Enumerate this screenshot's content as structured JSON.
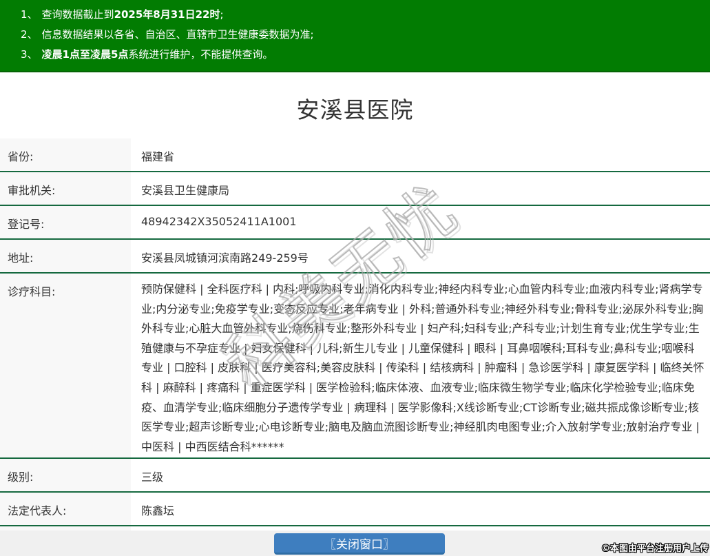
{
  "notice": {
    "items": [
      {
        "num": "1、",
        "pre": "查询数据截止到",
        "bold": "2025年8月31日22时",
        "post": ";"
      },
      {
        "num": "2、",
        "pre": "信息数据结果以各省、自治区、直辖市卫生健康委数据为准;",
        "bold": "",
        "post": ""
      },
      {
        "num": "3、",
        "pre": "",
        "bold": "凌晨1点至凌晨5点",
        "post": "系统进行维护，不能提供查询。"
      }
    ]
  },
  "title": "安溪县医院",
  "table": {
    "rows": [
      {
        "label": "省份:",
        "value": "福建省"
      },
      {
        "label": "审批机关:",
        "value": "安溪县卫生健康局"
      },
      {
        "label": "登记号:",
        "value": "48942342X35052411A1001"
      },
      {
        "label": "地址:",
        "value": "安溪县凤城镇河滨南路249-259号"
      },
      {
        "label": "诊疗科目:",
        "value": "预防保健科 | 全科医疗科 | 内科;呼吸内科专业;消化内科专业;神经内科专业;心血管内科专业;血液内科专业;肾病学专业;内分泌专业;免疫学专业;变态反应专业;老年病专业 | 外科;普通外科专业;神经外科专业;骨科专业;泌尿外科专业;胸外科专业;心脏大血管外科专业;烧伤科专业;整形外科专业 | 妇产科;妇科专业;产科专业;计划生育专业;优生学专业;生殖健康与不孕症专业 | 妇女保健科 | 儿科;新生儿专业 | 儿童保健科 | 眼科 | 耳鼻咽喉科;耳科专业;鼻科专业;咽喉科专业 | 口腔科 | 皮肤科 | 医疗美容科;美容皮肤科 | 传染科 | 结核病科 | 肿瘤科 | 急诊医学科 | 康复医学科 | 临终关怀科 | 麻醉科 | 疼痛科 | 重症医学科 | 医学检验科;临床体液、血液专业;临床微生物学专业;临床化学检验专业;临床免疫、血清学专业;临床细胞分子遗传学专业 | 病理科 | 医学影像科;X线诊断专业;CT诊断专业;磁共振成像诊断专业;核医学专业;超声诊断专业;心电诊断专业;脑电及脑血流图诊断专业;神经肌肉电图专业;介入放射学专业;放射治疗专业 | 中医科 | 中西医结合科******"
      },
      {
        "label": "级别:",
        "value": "三级"
      },
      {
        "label": "法定代表人:",
        "value": "陈鑫坛"
      }
    ]
  },
  "watermark": "科美无忧",
  "footer": {
    "close_button": "〖关闭窗口〗",
    "copyright": "©本图由平台注册用户上传"
  },
  "colors": {
    "header_green": "#027c02",
    "separator_green": "#15693f",
    "label_bg": "#f8f8f8",
    "button_blue": "#3e7ebf",
    "text": "#333333"
  }
}
